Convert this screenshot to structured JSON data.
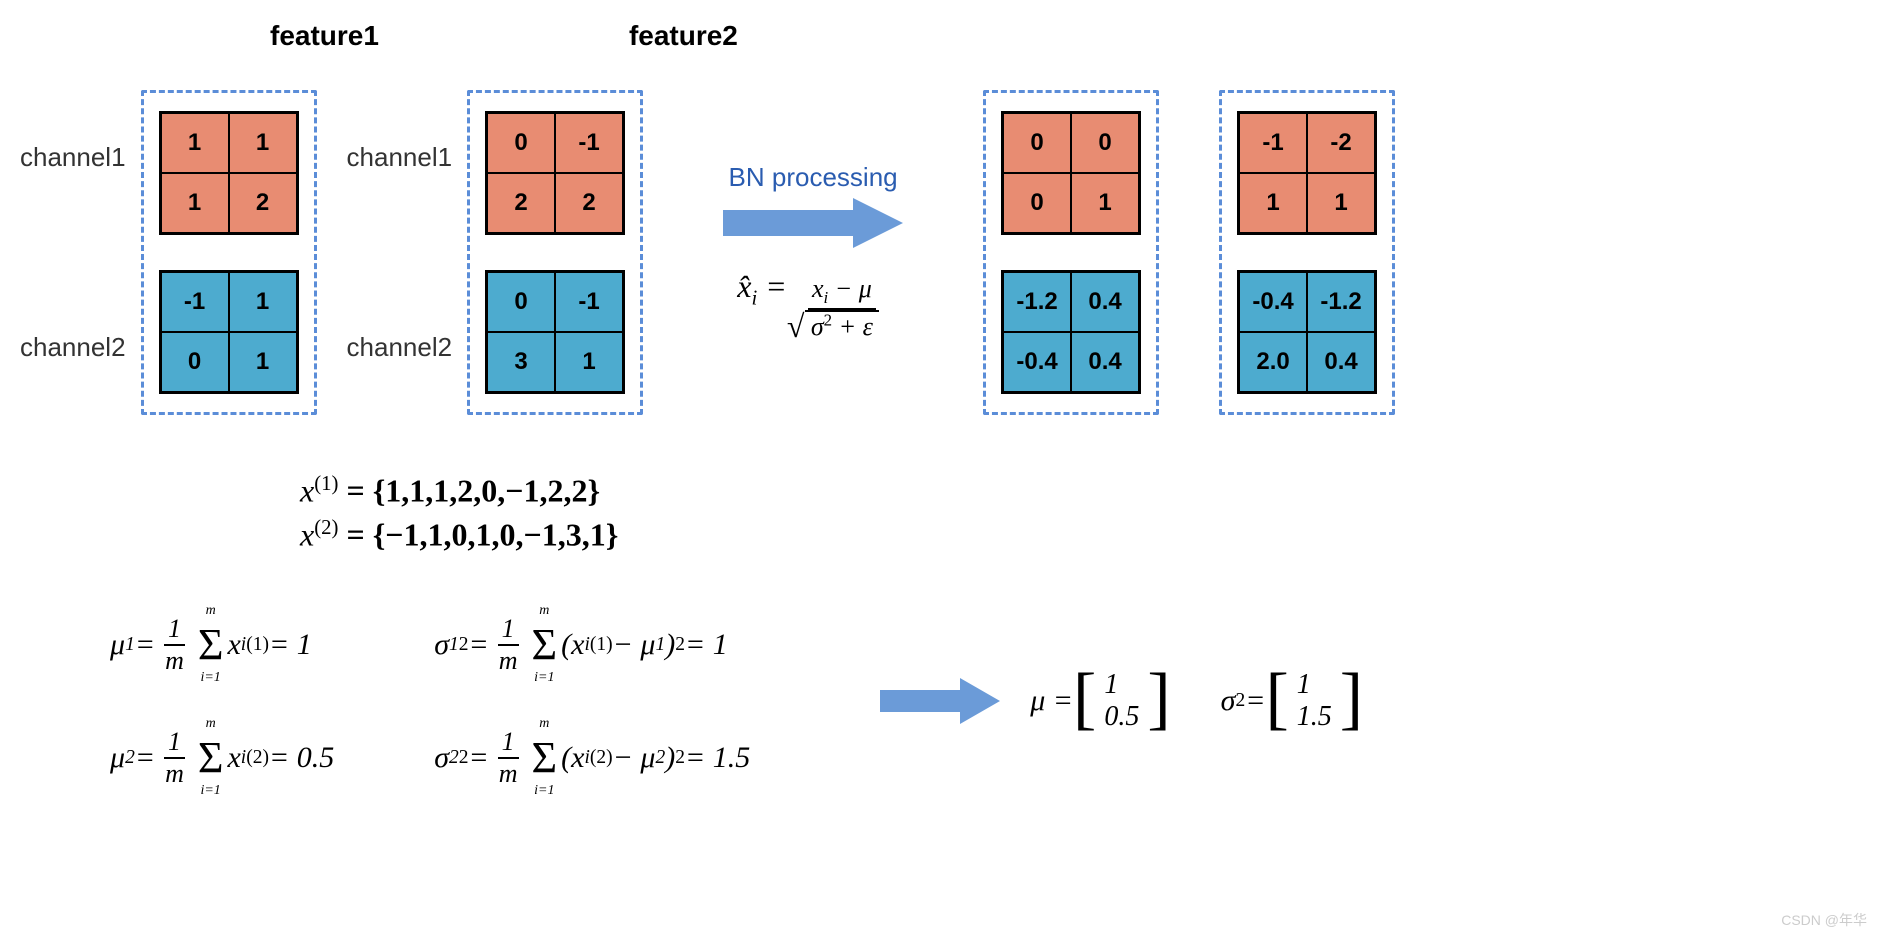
{
  "headers": {
    "feature1": "feature1",
    "feature2": "feature2"
  },
  "channels": {
    "ch1": "channel1",
    "ch2": "channel2"
  },
  "arrow_label": "BN processing",
  "bn_formula": {
    "lhs": "x̂",
    "lhs_sub": "i",
    "num_x": "x",
    "num_sub": "i",
    "num_minus": "− μ",
    "den_sigma": "σ",
    "den_sq": "2",
    "den_plus": "+ ε"
  },
  "input_grids": {
    "f1_ch1": [
      "1",
      "1",
      "1",
      "2"
    ],
    "f1_ch2": [
      "-1",
      "1",
      "0",
      "1"
    ],
    "f2_ch1": [
      "0",
      "-1",
      "2",
      "2"
    ],
    "f2_ch2": [
      "0",
      "-1",
      "3",
      "1"
    ]
  },
  "output_grids": {
    "o1_ch1": [
      "0",
      "0",
      "0",
      "1"
    ],
    "o1_ch2": [
      "-1.2",
      "0.4",
      "-0.4",
      "0.4"
    ],
    "o2_ch1": [
      "-1",
      "-2",
      "1",
      "1"
    ],
    "o2_ch2": [
      "-0.4",
      "-1.2",
      "2.0",
      "0.4"
    ]
  },
  "data_vectors": {
    "x1_label": "x",
    "x1_sup": "(1)",
    "x1_vals": "= {1,1,1,2,0,−1,2,2}",
    "x2_label": "x",
    "x2_sup": "(2)",
    "x2_vals": "= {−1,1,0,1,0,−1,3,1}"
  },
  "mu_formulas": {
    "mu1_lhs": "μ",
    "mu1_sub": "1",
    "equals": " = ",
    "frac_num": "1",
    "frac_den": "m",
    "sum_top": "m",
    "sum_bot": "i=1",
    "x": "x",
    "sup1": "(1)",
    "sub_i": "i",
    "mu1_result": " = 1",
    "mu2_lhs": "μ",
    "mu2_sub": "2",
    "sup2": "(2)",
    "mu2_result": " = 0.5"
  },
  "sigma_formulas": {
    "sigma1_lhs": "σ",
    "sigma1_sub": "1",
    "sq": "2",
    "open": "(",
    "minus": " − μ",
    "close": ")",
    "sigma1_result": " = 1",
    "sigma2_lhs": "σ",
    "sigma2_sub": "2",
    "sigma2_result": " = 1.5"
  },
  "result_vectors": {
    "mu_label": "μ = ",
    "mu_v1": "1",
    "mu_v2": "0.5",
    "sigma_label": "σ",
    "sigma_sq": "2",
    "sigma_eq": " = ",
    "sigma_v1": "1",
    "sigma_v2": "1.5"
  },
  "watermark": "CSDN @年华"
}
